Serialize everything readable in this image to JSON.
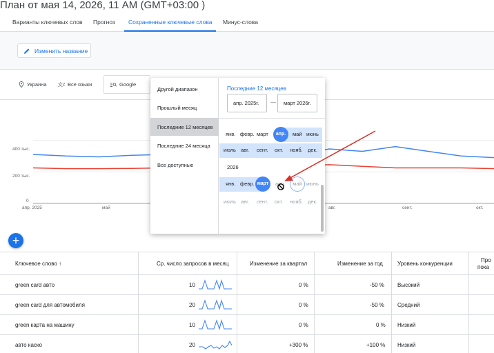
{
  "page": {
    "title": "План от мая 14, 2026, 11 AM (GMT+03:00 )"
  },
  "tabs": [
    {
      "label": "Варианты ключевых слов"
    },
    {
      "label": "Прогноз"
    },
    {
      "label": "Сохраненные ключевые слова"
    },
    {
      "label": "Минус-слова"
    }
  ],
  "toolbar": {
    "rename_label": "Изменить название",
    "rename_icon": "pencil-icon"
  },
  "filters": {
    "location": "Украина",
    "location_icon": "location-pin-icon",
    "languages": "Все языки",
    "languages_icon": "translate-icon",
    "network": "Google",
    "network_icon": "search-network-icon"
  },
  "chart_data": {
    "type": "line",
    "y_tick_labels": [
      "400 тыс.",
      "200 тыс.",
      "0"
    ],
    "x_tick_labels": [
      "апр. 2025",
      "май",
      "авг.",
      "сент.",
      "окт."
    ],
    "ylim": [
      0,
      450000
    ],
    "series": [
      {
        "color": "#4285f4",
        "values": [
          310000,
          300000,
          295000,
          305000,
          310000,
          300000,
          300000,
          305000,
          305000,
          345000,
          330000,
          360000,
          330000,
          300000,
          290000
        ]
      },
      {
        "color": "#ea4335",
        "values": [
          225000,
          220000,
          220000,
          222000,
          225000,
          230000,
          232000,
          235000,
          240000,
          245000,
          235000,
          225000,
          225000,
          225000,
          220000
        ]
      }
    ]
  },
  "date_picker": {
    "options": [
      "Другой диапазон",
      "Прошлый месяц",
      "Последние 12 месяцев",
      "Последние 24 месяца",
      "Все доступные"
    ],
    "selected_option": "Последние 12 месяцев",
    "range_title": "Последние 12 месяцев",
    "start_date": "апр. 2025г.",
    "end_date": "март 2026г.",
    "separator": "—",
    "year_label": "2026",
    "months_row1": [
      "янв.",
      "февр.",
      "март",
      "апр.",
      "май",
      "июнь"
    ],
    "months_row2": [
      "июль",
      "авг.",
      "сент.",
      "окт.",
      "нояб.",
      "дек."
    ],
    "months_row3": [
      "янв.",
      "февр.",
      "март",
      "апр.",
      "май",
      "июнь"
    ],
    "months_row4": [
      "июль",
      "авг.",
      "сент.",
      "окт.",
      "нояб.",
      "дек."
    ]
  },
  "table": {
    "headers": [
      "Ключевое слово",
      "Ср. число запросов в месяц",
      "Изменение за квартал",
      "Изменение за год",
      "Уровень конкуренции",
      "Про",
      "пока"
    ],
    "sort_indicator": "↑",
    "rows": [
      {
        "keyword": "green card авто",
        "searches": "10",
        "quarter": "0 %",
        "year": "-50 %",
        "competition": "Высокий"
      },
      {
        "keyword": "green card для автомобиля",
        "searches": "20",
        "quarter": "0 %",
        "year": "-50 %",
        "competition": "Средний"
      },
      {
        "keyword": "green карта на машину",
        "searches": "10",
        "quarter": "0 %",
        "year": "0 %",
        "competition": "Низкий"
      },
      {
        "keyword": "авто каско",
        "searches": "20",
        "quarter": "+300 %",
        "year": "+100 %",
        "competition": "Низкий"
      }
    ]
  },
  "colors": {
    "accent": "#1a73e8",
    "series_search": "#4285f4",
    "series_mobile": "#ea4335"
  }
}
